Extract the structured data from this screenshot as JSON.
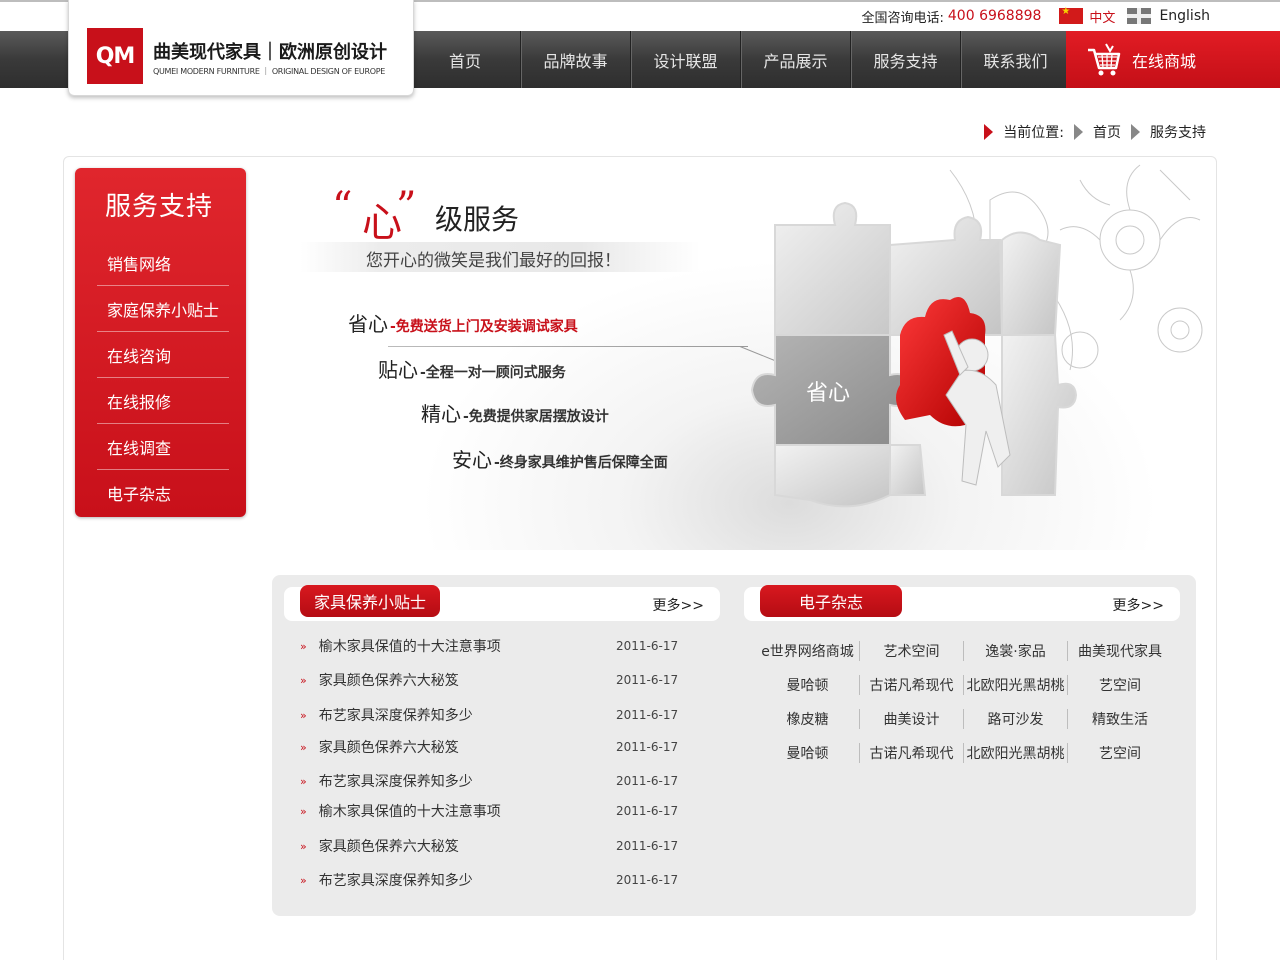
{
  "topbar": {
    "hotline_label": "全国咨询电话:",
    "hotline_number": "400 6968898",
    "lang_cn": "中文",
    "lang_en": "English"
  },
  "logo": {
    "mark": "QM",
    "title": "曲美现代家具｜欧洲原创设计",
    "subtitle": "QUMEI MODERN FURNITURE ｜ ORIGINAL DESIGN OF EUROPE"
  },
  "nav": {
    "items": [
      "首页",
      "品牌故事",
      "设计联盟",
      "产品展示",
      "服务支持",
      "联系我们"
    ],
    "shop": "在线商城"
  },
  "breadcrumb": {
    "label": "当前位置:",
    "home": "首页",
    "current": "服务支持"
  },
  "sidebar": {
    "title": "服务支持",
    "items": [
      "销售网络",
      "家庭保养小贴士",
      "在线咨询",
      "在线报修",
      "在线调查",
      "电子杂志"
    ]
  },
  "banner": {
    "quote_open": "“",
    "heart": "心",
    "quote_close": "”",
    "level": "级服务",
    "slogan": "您开心的微笑是我们最好的回报！",
    "puzzle_text": "省心",
    "features": [
      {
        "key": "省心",
        "desc": "-免费送货上门及安装调试家具"
      },
      {
        "key": "贴心",
        "desc": "-全程一对一顾问式服务"
      },
      {
        "key": "精心",
        "desc": "-免费提供家居摆放设计"
      },
      {
        "key": "安心",
        "desc": "-终身家具维护售后保障全面"
      }
    ]
  },
  "tips": {
    "title": "家具保养小贴士",
    "more": "更多>>",
    "rows": [
      {
        "title": "榆木家具保值的十大注意事项",
        "date": "2011-6-17"
      },
      {
        "title": "家具颜色保养六大秘笈",
        "date": "2011-6-17"
      },
      {
        "title": "布艺家具深度保养知多少",
        "date": "2011-6-17"
      },
      {
        "title": "家具颜色保养六大秘笈",
        "date": "2011-6-17"
      },
      {
        "title": "布艺家具深度保养知多少",
        "date": "2011-6-17"
      },
      {
        "title": "榆木家具保值的十大注意事项",
        "date": "2011-6-17"
      },
      {
        "title": "家具颜色保养六大秘笈",
        "date": "2011-6-17"
      },
      {
        "title": "布艺家具深度保养知多少",
        "date": "2011-6-17"
      }
    ]
  },
  "magazine": {
    "title": "电子杂志",
    "more": "更多>>",
    "rows": [
      [
        "e世界网络商城",
        "艺术空间",
        "逸裳·家品",
        "曲美现代家具"
      ],
      [
        "曼哈顿",
        "古诺凡希现代",
        "北欧阳光黑胡桃",
        "艺空间"
      ],
      [
        "橡皮糖",
        "曲美设计",
        "路可沙发",
        "精致生活"
      ],
      [
        "曼哈顿",
        "古诺凡希现代",
        "北欧阳光黑胡桃",
        "艺空间"
      ]
    ]
  },
  "colors": {
    "brand_red": "#c8101a",
    "nav_dark": "#3a3a3a",
    "panel_gray": "#ebebeb"
  }
}
